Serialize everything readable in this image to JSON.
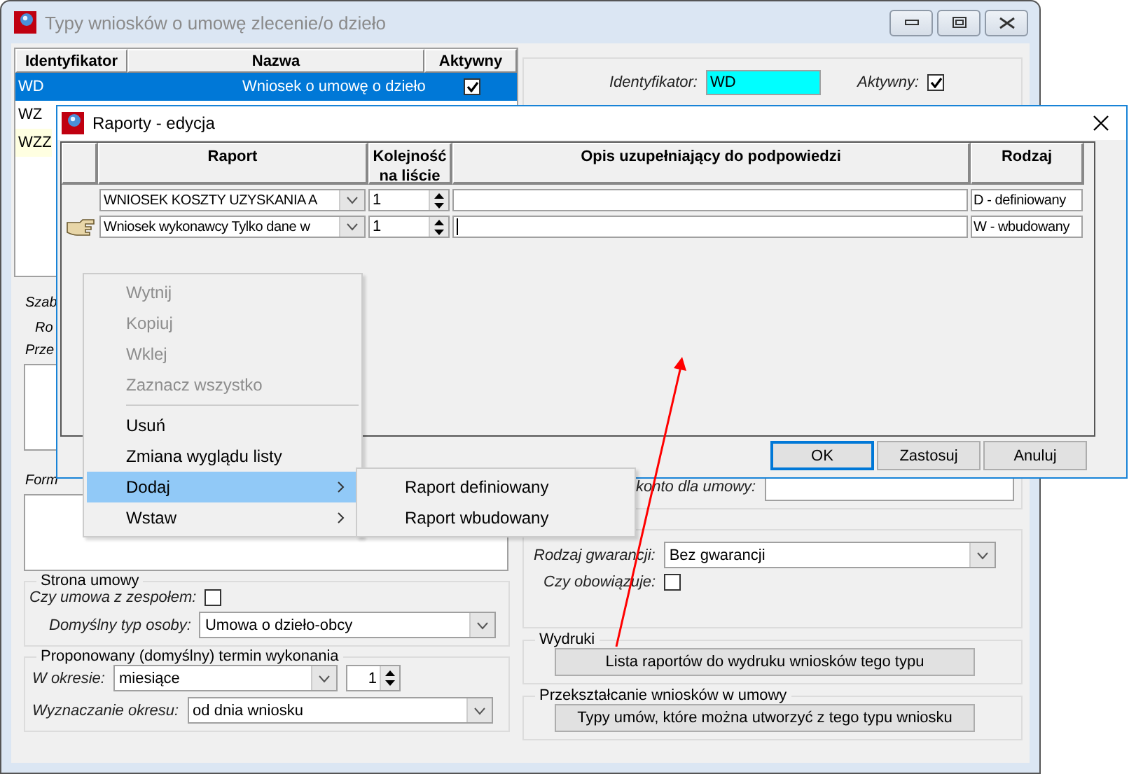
{
  "main_window": {
    "title": "Typy wniosków o umowę zlecenie/o dzieło",
    "active": false,
    "table": {
      "columns": [
        "Identyfikator",
        "Nazwa",
        "Aktywny"
      ],
      "rows": [
        {
          "id": "WD",
          "name": "Wniosek o umowę o dzieło",
          "active": true,
          "selected": true,
          "highlighted": false
        },
        {
          "id": "WZ",
          "selected": false,
          "highlighted": false
        },
        {
          "id": "WZZ",
          "selected": false,
          "highlighted": true
        }
      ]
    },
    "left_labels": [
      "Szab",
      "Ro",
      "Prze"
    ],
    "form_label": "Form",
    "strona_umowy": {
      "title": "Strona umowy",
      "team_label": "Czy umowa z zespołem:",
      "team_checked": false,
      "person_label": "Domyślny typ osoby:",
      "person_value": "Umowa o dzieło-obcy"
    },
    "termin": {
      "title": "Proponowany (domyślny) termin wykonania",
      "period_label": "W okresie:",
      "period_value": "miesiące",
      "period_count": "1",
      "calc_label": "Wyznaczanie okresu:",
      "calc_value": "od dnia wniosku"
    },
    "identyfikator": {
      "label": "Identyfikator:",
      "value": "WD",
      "active_label": "Aktywny:",
      "active_checked": true
    },
    "konto_label": "konto dla umowy:",
    "gwarancja": {
      "label": "Rodzaj gwarancji:",
      "value": "Bez gwarancji",
      "binding_label": "Czy obowiązuje:",
      "binding_checked": false
    },
    "wydruki": {
      "title": "Wydruki",
      "button": "Lista raportów do wydruku wniosków tego typu"
    },
    "przeksztalcanie": {
      "title": "Przekształcanie wniosków w umowy",
      "button": "Typy umów, które można utworzyć z tego typu wniosku"
    }
  },
  "dialog": {
    "title": "Raporty - edycja",
    "columns": [
      "Raport",
      "Kolejność na liście",
      "Opis uzupełniający do podpowiedzi",
      "Rodzaj"
    ],
    "rows": [
      {
        "report": "WNIOSEK KOSZTY UZYSKANIA A",
        "order": "1",
        "description": "",
        "kind": "D - definiowany",
        "current": false
      },
      {
        "report": "Wniosek wykonawcy Tylko dane w",
        "order": "1",
        "description": "",
        "kind": "W - wbudowany",
        "current": true
      }
    ],
    "buttons": [
      {
        "label": "OK",
        "default": true
      },
      {
        "label": "Zastosuj",
        "default": false
      },
      {
        "label": "Anuluj",
        "default": false
      }
    ]
  },
  "context_menu": {
    "items": [
      {
        "label": "Wytnij",
        "disabled": true,
        "highlighted": false,
        "submenu": false
      },
      {
        "label": "Kopiuj",
        "disabled": true,
        "highlighted": false,
        "submenu": false
      },
      {
        "label": "Wklej",
        "disabled": true,
        "highlighted": false,
        "submenu": false
      },
      {
        "label": "Zaznacz wszystko",
        "disabled": true,
        "highlighted": false,
        "submenu": false
      },
      {
        "kind": "separator"
      },
      {
        "label": "Usuń",
        "disabled": false,
        "highlighted": false,
        "submenu": false
      },
      {
        "label": "Zmiana wyglądu listy",
        "disabled": false,
        "highlighted": false,
        "submenu": false
      },
      {
        "label": "Dodaj",
        "disabled": false,
        "highlighted": true,
        "submenu": true
      },
      {
        "label": "Wstaw",
        "disabled": false,
        "highlighted": false,
        "submenu": true
      }
    ],
    "submenu": [
      "Raport definiowany",
      "Raport wbudowany"
    ]
  }
}
